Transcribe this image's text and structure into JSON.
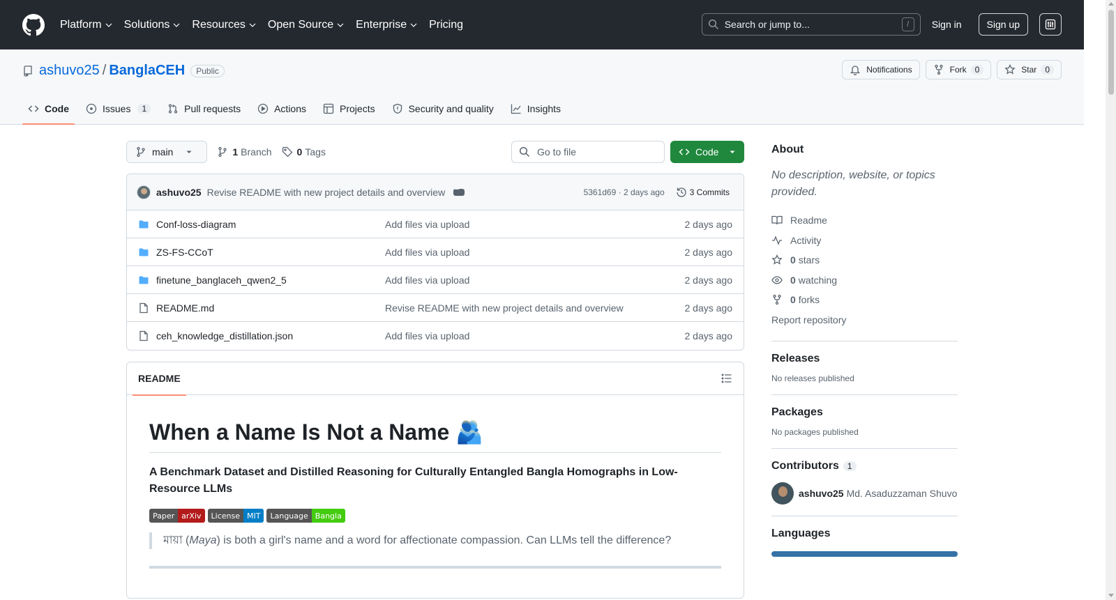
{
  "header": {
    "nav": [
      "Platform",
      "Solutions",
      "Resources",
      "Open Source",
      "Enterprise",
      "Pricing"
    ],
    "search_placeholder": "Search or jump to...",
    "search_key": "/",
    "signin": "Sign in",
    "signup": "Sign up"
  },
  "repo": {
    "owner": "ashuvo25",
    "separator": "/",
    "name": "BanglaCEH",
    "visibility": "Public",
    "notifications": "Notifications",
    "fork_label": "Fork",
    "fork_count": "0",
    "star_label": "Star",
    "star_count": "0",
    "tabs": [
      {
        "label": "Code"
      },
      {
        "label": "Issues",
        "count": "1"
      },
      {
        "label": "Pull requests"
      },
      {
        "label": "Actions"
      },
      {
        "label": "Projects"
      },
      {
        "label": "Security and quality"
      },
      {
        "label": "Insights"
      }
    ]
  },
  "toolbar": {
    "branch": "main",
    "branch_count": "1",
    "branch_label": "Branch",
    "tag_count": "0",
    "tag_label": "Tags",
    "goto_placeholder": "Go to file",
    "code_button": "Code"
  },
  "commit": {
    "author": "ashuvo25",
    "message": "Revise README with new project details and overview",
    "meta": "5361d69 · 2 days ago",
    "commits": "3 Commits"
  },
  "files": [
    {
      "type": "folder",
      "name": "Conf-loss-diagram",
      "message": "Add files via upload",
      "date": "2 days ago"
    },
    {
      "type": "folder",
      "name": "ZS-FS-CCoT",
      "message": "Add files via upload",
      "date": "2 days ago"
    },
    {
      "type": "folder",
      "name": "finetune_banglaceh_qwen2_5",
      "message": "Add files via upload",
      "date": "2 days ago"
    },
    {
      "type": "file",
      "name": "README.md",
      "message": "Revise README with new project details and overview",
      "date": "2 days ago"
    },
    {
      "type": "file",
      "name": "ceh_knowledge_distillation.json",
      "message": "Add files via upload",
      "date": "2 days ago"
    }
  ],
  "readme": {
    "tab": "README",
    "title": "When a Name Is Not a Name 🫂",
    "subtitle": "A Benchmark Dataset and Distilled Reasoning for Culturally Entangled Bangla Homographs in Low-Resource LLMs",
    "shields": [
      {
        "label": "Paper",
        "value": "arXiv",
        "color": "#b31b1b"
      },
      {
        "label": "License",
        "value": "MIT",
        "color": "#007ec6"
      },
      {
        "label": "Language",
        "value": "Bangla",
        "color": "#4c1"
      }
    ],
    "quote_prefix": "মায়া (",
    "quote_em": "Maya",
    "quote_rest": ") is both a girl's name and a word for affectionate compassion. Can LLMs tell the difference?"
  },
  "sidebar": {
    "about_title": "About",
    "about_desc": "No description, website, or topics provided.",
    "readme": "Readme",
    "activity": "Activity",
    "stars_count": "0",
    "stars_label": "stars",
    "watching_count": "0",
    "watching_label": "watching",
    "forks_count": "0",
    "forks_label": "forks",
    "report": "Report repository",
    "releases_title": "Releases",
    "releases_empty": "No releases published",
    "packages_title": "Packages",
    "packages_empty": "No packages published",
    "contributors_title": "Contributors",
    "contributors_count": "1",
    "contributor_login": "ashuvo25",
    "contributor_name": "Md. Asaduzzaman Shuvo",
    "languages_title": "Languages"
  },
  "colors": {
    "header_bg": "#24292f",
    "link": "#0969da",
    "primary_green": "#1f883d",
    "tab_underline": "#fd8c73",
    "folder": "#54aeff",
    "python": "#3572A5"
  }
}
